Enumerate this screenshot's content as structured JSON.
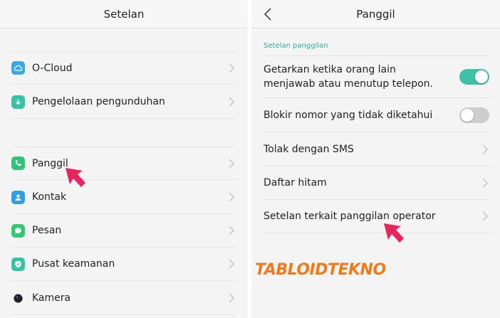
{
  "left_screen": {
    "title": "Setelan",
    "items": [
      {
        "label": "O-Cloud",
        "icon": "cloud-icon",
        "color": "#3aa7e8"
      },
      {
        "label": "Pengelolaan pengunduhan",
        "icon": "download-icon",
        "color": "#37c3a3"
      },
      {
        "label": "Panggil",
        "icon": "phone-icon",
        "color": "#33c27a"
      },
      {
        "label": "Kontak",
        "icon": "contact-icon",
        "color": "#2e9fe6"
      },
      {
        "label": "Pesan",
        "icon": "message-icon",
        "color": "#36c86e"
      },
      {
        "label": "Pusat keamanan",
        "icon": "shield-icon",
        "color": "#37c3a3"
      },
      {
        "label": "Kamera",
        "icon": "camera-icon",
        "color": "#1f2230"
      }
    ]
  },
  "right_screen": {
    "title": "Panggil",
    "section_label": "Setelan panggilan",
    "items": [
      {
        "label": "Getarkan ketika orang lain menjawab atau menutup telepon.",
        "control": "toggle",
        "state": "on"
      },
      {
        "label": "Blokir nomor yang tidak diketahui",
        "control": "toggle",
        "state": "off"
      },
      {
        "label": "Tolak dengan SMS",
        "control": "chevron"
      },
      {
        "label": "Daftar hitam",
        "control": "chevron"
      },
      {
        "label": "Setelan terkait panggilan operator",
        "control": "chevron"
      }
    ]
  },
  "watermark": "TABLOIDTEKNO",
  "colors": {
    "accent": "#3fc1a5",
    "arrow": "#e8245c",
    "watermark": "#f07a1a"
  }
}
